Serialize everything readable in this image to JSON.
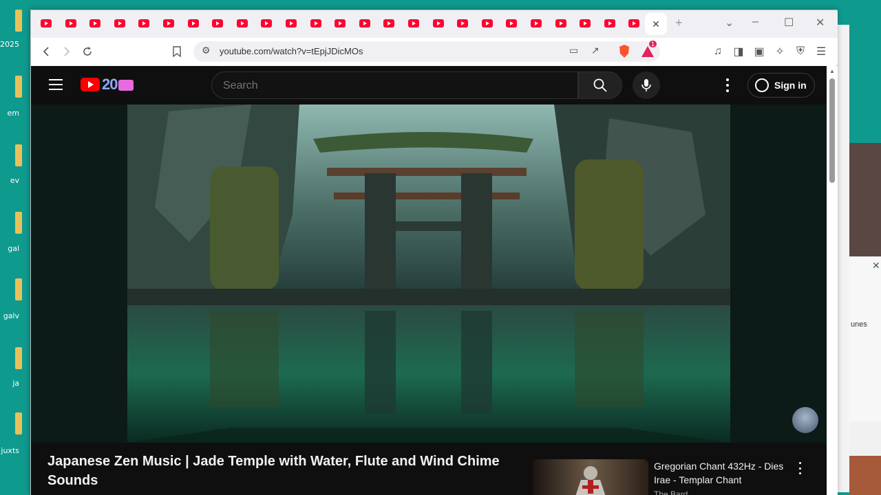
{
  "desktop": {
    "icons": [
      "2025",
      "em",
      "ev",
      "gal",
      "galv",
      "ja",
      "juxts"
    ],
    "bg_window_text": "unes"
  },
  "browser": {
    "tab_count": 25,
    "active_tab_close": "✕",
    "new_tab": "+",
    "window_controls": [
      "⌄",
      "–",
      "☐",
      "✕"
    ],
    "url": "youtube.com/watch?v=tEpjJDicMOs",
    "brave_badge": "1"
  },
  "youtube": {
    "logo_text": "20",
    "search_placeholder": "Search",
    "signin_label": "Sign in"
  },
  "video": {
    "title": "Japanese Zen Music | Jade Temple with Water, Flute and Wind Chime Sounds"
  },
  "recommendation": {
    "title": "Gregorian Chant 432Hz - Dies Irae - Templar Chant",
    "channel": "The Bard"
  },
  "colors": {
    "youtube_red": "#ff0000",
    "page_bg": "#0f0f0f",
    "desktop_bg": "#0f9a8e"
  }
}
